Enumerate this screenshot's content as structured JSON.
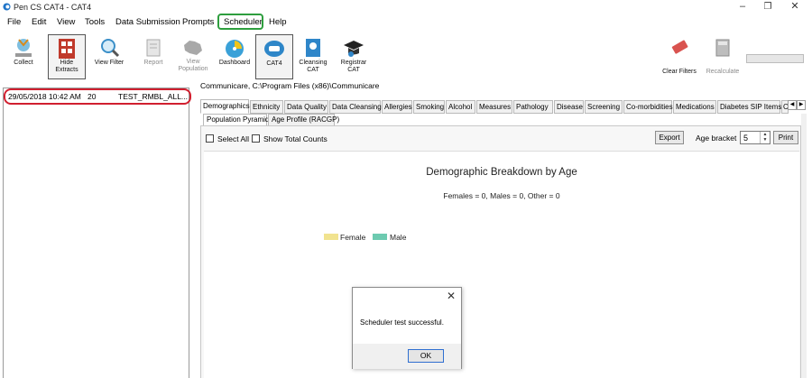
{
  "window": {
    "title": "Pen CS CAT4 - CAT4"
  },
  "menu": {
    "items": [
      "File",
      "Edit",
      "View",
      "Tools",
      "Data Submission",
      "Prompts",
      "Scheduler",
      "Help"
    ]
  },
  "toolbar": {
    "collect": "Collect",
    "hide_extracts": "Hide Extracts",
    "view_filter": "View Filter",
    "report": "Report",
    "view_population": "View Population",
    "dashboard": "Dashboard",
    "cat4": "CAT4",
    "cleansing_cat": "Cleansing CAT",
    "registrar_cat": "Registrar CAT",
    "clear_filters": "Clear Filters",
    "recalculate": "Recalculate"
  },
  "extracts": [
    {
      "date": "29/05/2018 10:42 AM",
      "count": "20",
      "name": "TEST_RMBL_ALL..."
    }
  ],
  "path": "Communicare, C:\\Program Files (x86)\\Communicare",
  "tabs": [
    "Demographics",
    "Ethnicity",
    "Data Quality",
    "Data Cleansing",
    "Allergies",
    "Smoking",
    "Alcohol",
    "Measures",
    "Pathology",
    "Disease",
    "Screening",
    "Co-morbidities",
    "Medications",
    "Diabetes SIP Items",
    "C"
  ],
  "subtabs": [
    "Population Pyramid",
    "Age Profile (RACGP)"
  ],
  "options": {
    "select_all": "Select All",
    "show_total_counts": "Show Total Counts",
    "export": "Export",
    "age_bracket_label": "Age bracket",
    "age_bracket_value": "5",
    "print": "Print"
  },
  "chart": {
    "title": "Demographic Breakdown by Age",
    "subtitle": "Females = 0, Males = 0, Other = 0",
    "legend": [
      {
        "label": "Female",
        "color": "#f1e38f"
      },
      {
        "label": "Male",
        "color": "#6dcab0"
      }
    ]
  },
  "dialog": {
    "message": "Scheduler test successful.",
    "ok": "OK"
  },
  "colors": {
    "menu_highlight": "#2e9e3e",
    "row_highlight": "#d11f2f"
  }
}
